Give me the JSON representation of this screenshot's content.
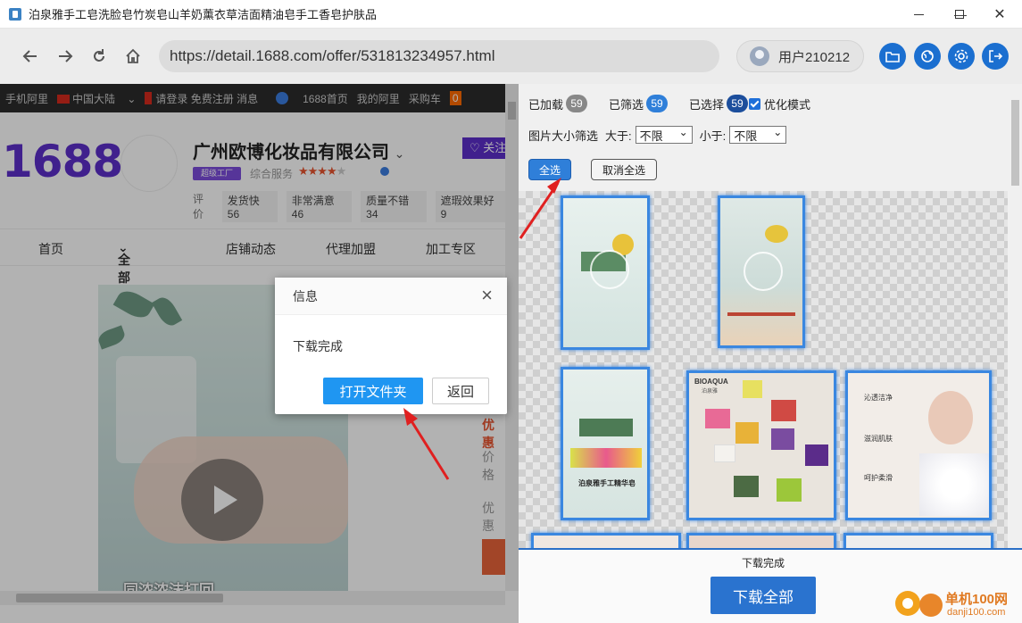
{
  "window": {
    "title": "泊泉雅手工皂洗脸皂竹炭皂山羊奶薰衣草洁面精油皂手工香皂护肤品",
    "controls": {
      "minimize": "—",
      "maximize": "☐",
      "close": "✕"
    }
  },
  "toolbar": {
    "url": "https://detail.1688.com/offer/531813234957.html",
    "user": "用户210212",
    "icons": [
      "back-icon",
      "forward-icon",
      "refresh-icon",
      "home-icon",
      "folder-icon",
      "globe-icon",
      "gear-icon",
      "exit-icon"
    ]
  },
  "webpage": {
    "topstrip": [
      "手机阿里",
      "中国大陆",
      "请登录 免费注册 消息",
      "1688首页",
      "我的阿里",
      "采购车",
      "0"
    ],
    "logo": "1688",
    "shop_name": "广州欧博化妆品有限公司",
    "follow": "关注",
    "factory_badge": "超级工厂",
    "service_label": "综合服务",
    "rating_label": "评价",
    "ratings": [
      {
        "name": "发货快",
        "value": "56"
      },
      {
        "name": "非常满意",
        "value": "46"
      },
      {
        "name": "质量不错",
        "value": "34"
      },
      {
        "name": "遮瑕效果好",
        "value": "9"
      }
    ],
    "tabs": [
      "首页",
      "全部商品",
      "店铺动态",
      "代理加盟",
      "加工专区"
    ],
    "side_texts": [
      "优惠",
      "价格",
      "优惠"
    ],
    "video_caption": "同浓浓沫打回"
  },
  "panel": {
    "loaded_label": "已加载",
    "loaded_count": "59",
    "filtered_label": "已筛选",
    "filtered_count": "59",
    "selected_label": "已选择",
    "selected_count": "59",
    "optimize_label": "优化模式",
    "size_filter_label": "图片大小筛选",
    "greater_label": "大于:",
    "greater_value": "不限",
    "less_label": "小于:",
    "less_value": "不限",
    "select_all": "全选",
    "deselect_all": "取消全选",
    "status": "下载完成",
    "download_all": "下载全部",
    "thumbs": {
      "brand": "BIOAQUA",
      "brand_sub": "泊泉雅",
      "card_caption": "泊泉雅手工精华皂",
      "features": [
        "沁透洁净",
        "滋润肌肤",
        "呵护柔滑"
      ]
    }
  },
  "dialog": {
    "title": "信息",
    "message": "下载完成",
    "open_folder": "打开文件夹",
    "back": "返回"
  },
  "watermark": {
    "text1": "单机100网",
    "text2": "danji100.com"
  },
  "colors": {
    "accent": "#2a73cf",
    "brand": "#5c2ecb",
    "arrow": "#e02020"
  }
}
